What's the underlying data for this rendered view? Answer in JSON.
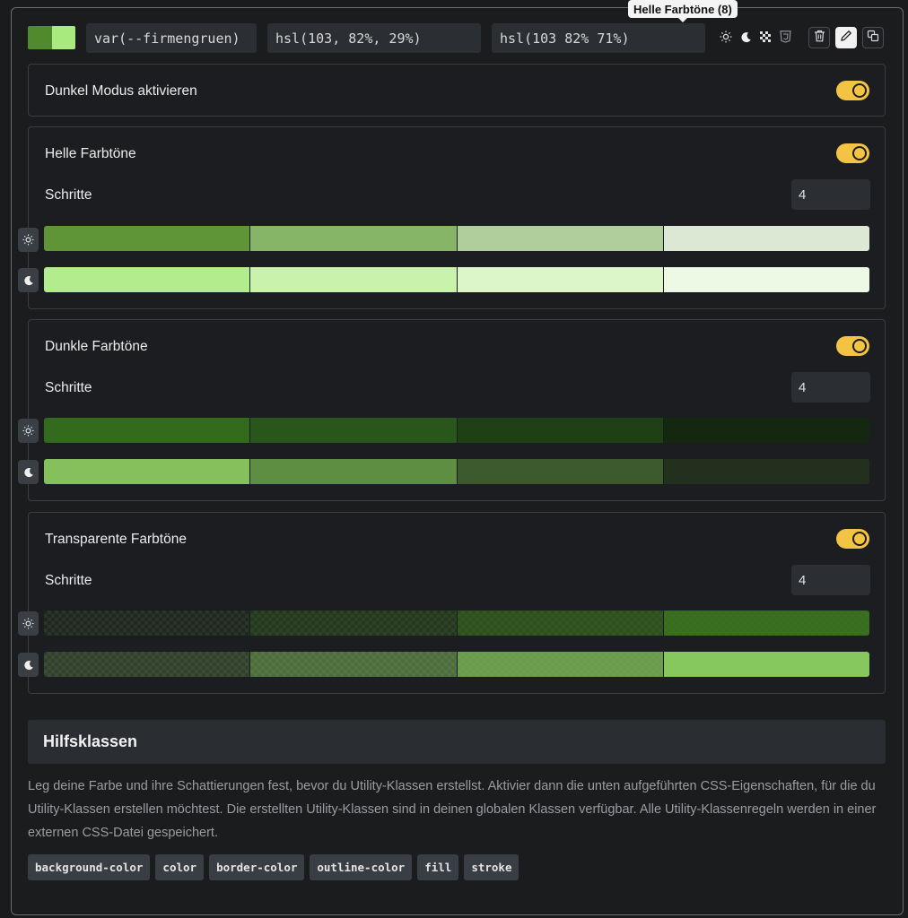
{
  "top": {
    "swatch_colors": [
      "#4f8a2d",
      "#a8ea7d"
    ],
    "variable": "var(--firmengruen)",
    "hsl_light": "hsl(103, 82%, 29%)",
    "hsl_dark": "hsl(103 82% 71%)",
    "tooltip": "Helle Farbtöne (8)",
    "icons": [
      "sun-icon",
      "moon-icon",
      "grid-icon",
      "css3-icon"
    ],
    "buttons": [
      "trash-icon",
      "pencil-icon",
      "copy-icon"
    ]
  },
  "dark_mode": {
    "label": "Dunkel Modus aktivieren",
    "enabled": true
  },
  "light_shades": {
    "title": "Helle Farbtöne",
    "steps_label": "Schritte",
    "steps": "4",
    "light_row": [
      "#5f9536",
      "#86b567",
      "#b0cd9c",
      "#dce7d4"
    ],
    "dark_row": [
      "#b3ec8c",
      "#c9f2ad",
      "#dcf6ca",
      "#eef9e5"
    ]
  },
  "dark_shades": {
    "title": "Dunkle Farbtöne",
    "steps_label": "Schritte",
    "steps": "4",
    "light_row": [
      "#336b1d",
      "#29561a",
      "#1f3f15",
      "#142810"
    ],
    "dark_row": [
      "#85c05d",
      "#5d8e42",
      "#3c5a2d",
      "#22301d"
    ]
  },
  "transparent_shades": {
    "title": "Transparente Farbtöne",
    "steps_label": "Schritte",
    "steps": "4",
    "light_row": [
      0.12,
      0.3,
      0.55,
      0.85
    ],
    "dark_row": [
      0.2,
      0.45,
      0.7,
      0.95
    ],
    "light_base": "#3d7a1f",
    "dark_base": "#8bd160"
  },
  "utility": {
    "heading": "Hilfsklassen",
    "description": "Leg deine Farbe und ihre Schattierungen fest, bevor du Utility-Klassen erstellst. Aktivier dann die unten aufgeführten CSS-Eigenschaften, für die du Utility-Klassen erstellen möchtest. Die erstellten Utility-Klassen sind in deinen globalen Klassen verfügbar. Alle Utility-Klassenregeln werden in einer externen CSS-Datei gespeichert.",
    "chips": [
      "background-color",
      "color",
      "border-color",
      "outline-color",
      "fill",
      "stroke"
    ]
  }
}
